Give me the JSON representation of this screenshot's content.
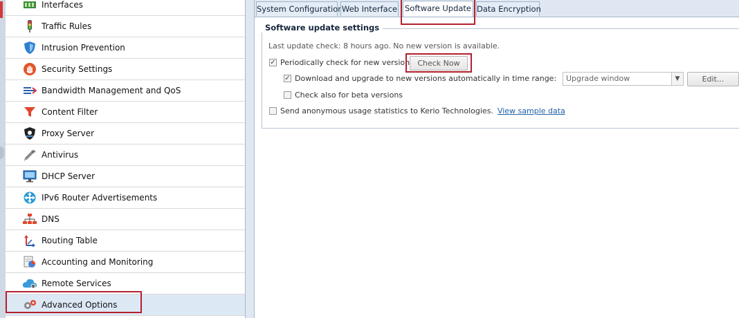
{
  "sidebar": {
    "items": [
      {
        "label": "Interfaces",
        "icon": "interfaces-icon"
      },
      {
        "label": "Traffic Rules",
        "icon": "traffic-light-icon"
      },
      {
        "label": "Intrusion Prevention",
        "icon": "shield-icon"
      },
      {
        "label": "Security Settings",
        "icon": "hand-icon"
      },
      {
        "label": "Bandwidth Management and QoS",
        "icon": "bandwidth-icon"
      },
      {
        "label": "Content Filter",
        "icon": "funnel-icon"
      },
      {
        "label": "Proxy Server",
        "icon": "proxy-shield-icon"
      },
      {
        "label": "Antivirus",
        "icon": "syringe-icon"
      },
      {
        "label": "DHCP Server",
        "icon": "monitor-icon"
      },
      {
        "label": "IPv6 Router Advertisements",
        "icon": "ipv6-icon"
      },
      {
        "label": "DNS",
        "icon": "network-tree-icon"
      },
      {
        "label": "Routing Table",
        "icon": "routing-arrows-icon"
      },
      {
        "label": "Accounting and Monitoring",
        "icon": "chart-doc-icon"
      },
      {
        "label": "Remote Services",
        "icon": "cloud-gear-icon"
      },
      {
        "label": "Advanced Options",
        "icon": "gears-icon"
      }
    ],
    "selected_label": "Advanced Options"
  },
  "tabs": [
    {
      "label": "System Configuration"
    },
    {
      "label": "Web Interface"
    },
    {
      "label": "Software Update"
    },
    {
      "label": "Data Encryption"
    }
  ],
  "active_tab": "Software Update",
  "panel": {
    "legend": "Software update settings",
    "last_check": "Last update check: 8 hours ago. No new version is available.",
    "periodic_label": "Periodically check for new versions",
    "periodic_checked": true,
    "check_now_label": "Check Now",
    "download_label": "Download and upgrade to new versions automatically in time range:",
    "download_checked": true,
    "time_range_value": "Upgrade window",
    "edit_label": "Edit...",
    "beta_label": "Check also for beta versions",
    "beta_checked": false,
    "stats_label": "Send anonymous usage statistics to Kerio Technologies.",
    "stats_checked": false,
    "sample_link": "View sample data"
  },
  "colors": {
    "highlight": "#b21f2d",
    "tab_active": "#ffffff",
    "tab_inactive": "#e4ecf6",
    "link": "#1e5fa8",
    "selected_row": "#dde8f5"
  }
}
